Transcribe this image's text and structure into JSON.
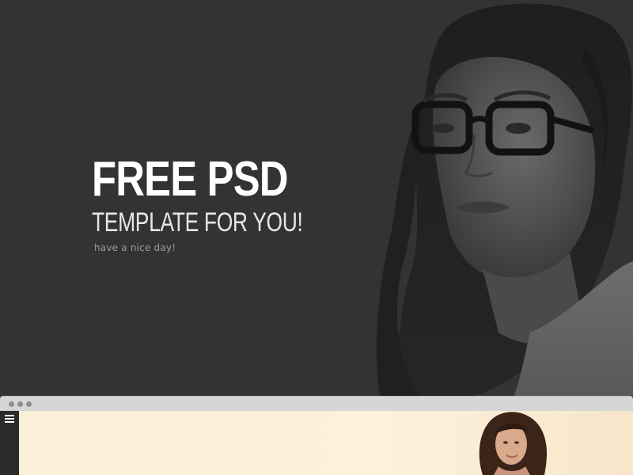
{
  "hero": {
    "headline": "FREE PSD",
    "subheadline": "TEMPLATE FOR YOU!",
    "tagline": "have a nice day!",
    "background_color": "#333333",
    "portrait_icon": "portrait-photo"
  },
  "browser": {
    "window_controls": [
      "dot",
      "dot",
      "dot"
    ],
    "menu_icon": "hamburger-menu-icon",
    "content_background": "#fbefd9",
    "photo_icon": "model-photo"
  }
}
